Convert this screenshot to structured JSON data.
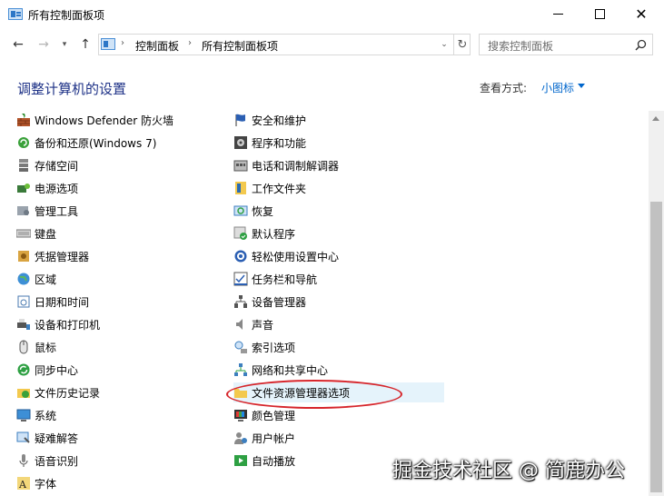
{
  "window": {
    "title": "所有控制面板项",
    "close_glyph": "✕"
  },
  "nav": {
    "back_glyph": "←",
    "forward_glyph": "→",
    "recent_glyph": "▾",
    "up_glyph": "↑",
    "breadcrumbs": [
      "控制面板",
      "所有控制面板项"
    ],
    "crumb_sep": "›",
    "address_drop_glyph": "⌄",
    "refresh_glyph": "↻",
    "search_placeholder": "搜索控制面板"
  },
  "header": {
    "title": "调整计算机的设置",
    "view_by_label": "查看方式:",
    "view_by_value": "小图标"
  },
  "items": {
    "left": [
      {
        "label": "Windows Defender 防火墙",
        "icon": "firewall-icon"
      },
      {
        "label": "备份和还原(Windows 7)",
        "icon": "backup-icon"
      },
      {
        "label": "存储空间",
        "icon": "storage-icon"
      },
      {
        "label": "电源选项",
        "icon": "power-icon"
      },
      {
        "label": "管理工具",
        "icon": "admin-tools-icon"
      },
      {
        "label": "键盘",
        "icon": "keyboard-icon"
      },
      {
        "label": "凭据管理器",
        "icon": "credential-icon"
      },
      {
        "label": "区域",
        "icon": "region-icon"
      },
      {
        "label": "日期和时间",
        "icon": "datetime-icon"
      },
      {
        "label": "设备和打印机",
        "icon": "printer-icon"
      },
      {
        "label": "鼠标",
        "icon": "mouse-icon"
      },
      {
        "label": "同步中心",
        "icon": "sync-icon"
      },
      {
        "label": "文件历史记录",
        "icon": "file-history-icon"
      },
      {
        "label": "系统",
        "icon": "system-icon"
      },
      {
        "label": "疑难解答",
        "icon": "troubleshoot-icon"
      },
      {
        "label": "语音识别",
        "icon": "speech-icon"
      },
      {
        "label": "字体",
        "icon": "fonts-icon"
      }
    ],
    "right": [
      {
        "label": "安全和维护",
        "icon": "flag-icon"
      },
      {
        "label": "程序和功能",
        "icon": "programs-icon"
      },
      {
        "label": "电话和调制解调器",
        "icon": "phone-icon"
      },
      {
        "label": "工作文件夹",
        "icon": "work-folders-icon"
      },
      {
        "label": "恢复",
        "icon": "recovery-icon"
      },
      {
        "label": "默认程序",
        "icon": "default-programs-icon"
      },
      {
        "label": "轻松使用设置中心",
        "icon": "ease-of-access-icon"
      },
      {
        "label": "任务栏和导航",
        "icon": "taskbar-icon"
      },
      {
        "label": "设备管理器",
        "icon": "device-manager-icon"
      },
      {
        "label": "声音",
        "icon": "sound-icon"
      },
      {
        "label": "索引选项",
        "icon": "indexing-icon"
      },
      {
        "label": "网络和共享中心",
        "icon": "network-icon"
      },
      {
        "label": "文件资源管理器选项",
        "icon": "folder-options-icon"
      },
      {
        "label": "颜色管理",
        "icon": "color-management-icon"
      },
      {
        "label": "用户帐户",
        "icon": "user-accounts-icon"
      },
      {
        "label": "自动播放",
        "icon": "autoplay-icon"
      }
    ],
    "selected_right_index": 12
  },
  "watermark": "掘金技术社区 @ 简鹿办公",
  "colors": {
    "heading": "#1e3287",
    "link": "#0066cc",
    "selection": "#e5f3fb",
    "annotation": "#d6252b"
  }
}
